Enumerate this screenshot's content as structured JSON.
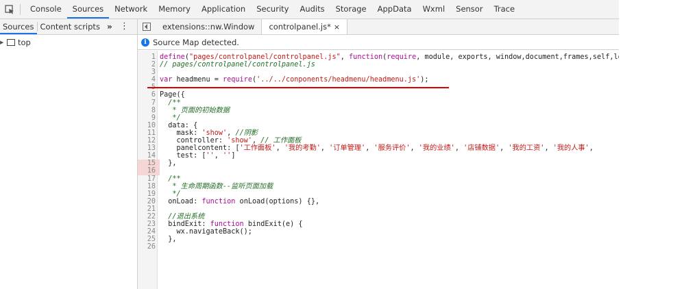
{
  "toolbar": {
    "tabs": [
      "Console",
      "Sources",
      "Network",
      "Memory",
      "Application",
      "Security",
      "Audits",
      "Storage",
      "AppData",
      "Wxml",
      "Sensor",
      "Trace"
    ],
    "active_tab": "Sources"
  },
  "navigator": {
    "tabs": [
      "Sources",
      "Content scripts"
    ],
    "more": "»",
    "menu": "⋮",
    "tree_root": "top"
  },
  "editor": {
    "tabs": [
      {
        "label": "extensions::nw.Window"
      },
      {
        "label": "controlpanel.js*",
        "close": "×"
      }
    ],
    "info_message": "Source Map detected.",
    "lines": [
      "define(\"pages/controlpanel/controlpanel.js\", function(require, module, exports, window,document,frames,self,lo",
      "// pages/controlpanel/controlpanel.js",
      "",
      "var headmenu = require('../../conponents/headmenu/headmenu.js');",
      "",
      "Page({",
      "  /**",
      "   * 页面的初始数据",
      "   */",
      "  data: {",
      "    mask: 'show', //阴影",
      "    controller: 'show', // 工作面板",
      "    panelcontent: ['工作面板', '我的考勤', '订单管理', '服务评价', '我的业绩', '店铺数据', '我的工资', '我的人事',",
      "    test: ['', '']",
      "  },",
      "",
      "  /**",
      "   * 生命周期函数--监听页面加载",
      "   */",
      "  onLoad: function onLoad(options) {},",
      "",
      "  //退出系统",
      "  bindExit: function bindExit(e) {",
      "    wx.navigateBack();",
      "  },",
      ""
    ]
  }
}
